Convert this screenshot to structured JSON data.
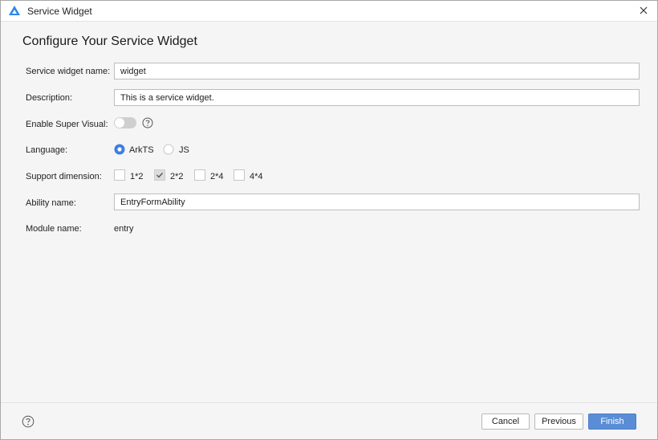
{
  "window": {
    "title": "Service Widget"
  },
  "page": {
    "title": "Configure Your Service Widget"
  },
  "form": {
    "name_label": "Service widget name:",
    "name_value": "widget",
    "description_label": "Description:",
    "description_value": "This is a service widget.",
    "super_visual_label": "Enable Super Visual:",
    "super_visual_enabled": false,
    "language_label": "Language:",
    "language_options": [
      "ArkTS",
      "JS"
    ],
    "language_selected": "ArkTS",
    "dimension_label": "Support dimension:",
    "dimension_options": [
      {
        "label": "1*2",
        "checked": false
      },
      {
        "label": "2*2",
        "checked": true
      },
      {
        "label": "2*4",
        "checked": false
      },
      {
        "label": "4*4",
        "checked": false
      }
    ],
    "ability_label": "Ability name:",
    "ability_value": "EntryFormAbility",
    "module_label": "Module name:",
    "module_value": "entry"
  },
  "footer": {
    "cancel_label": "Cancel",
    "previous_label": "Previous",
    "finish_label": "Finish"
  },
  "colors": {
    "accent": "#3d7ee0",
    "primary_button": "#5a8dd6",
    "logo_blue": "#2f86e8"
  },
  "icons": {
    "logo": "app-logo-icon",
    "close": "close-icon",
    "help": "help-circle-icon",
    "check": "checkmark-icon"
  }
}
